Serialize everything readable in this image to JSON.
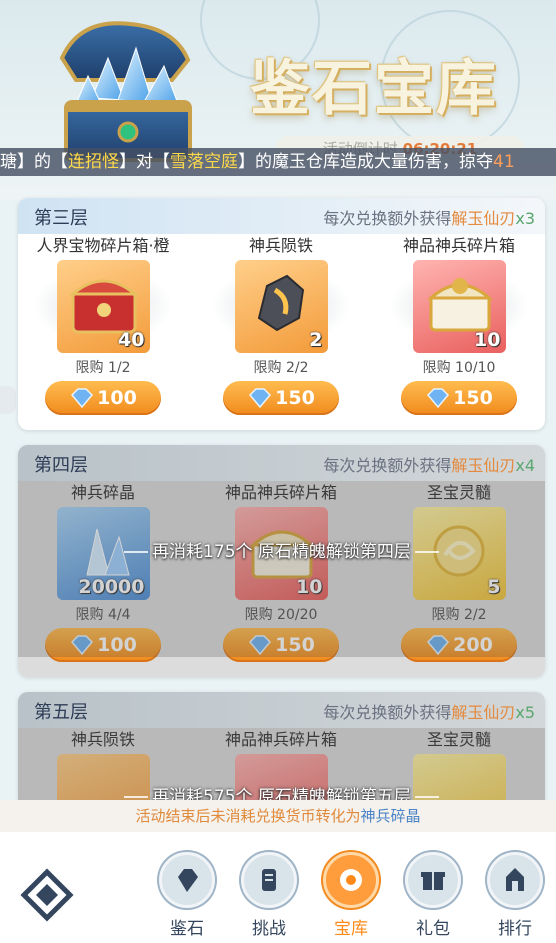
{
  "header": {
    "title": "鉴石宝库",
    "countdown_label": "活动倒计时",
    "countdown_time": "06:20:21",
    "ticker": {
      "part1": "瑭",
      "bracket_open": "】的【",
      "name1": "连招怪",
      "mid": "】对【",
      "place": "雪落空庭",
      "tail": "】的魔玉仓库造成大量伤害，掠夺",
      "amount": "41"
    }
  },
  "tiers": [
    {
      "name": "第三层",
      "bonus_prefix": "每次兑换额外获得",
      "bonus_item": "解玉仙刃",
      "bonus_mult": "x3",
      "locked": false,
      "lock_msg": "",
      "items": [
        {
          "name": "人界宝物碎片箱·橙",
          "qty": "40",
          "limit": "限购 1/2",
          "price": "100"
        },
        {
          "name": "神兵陨铁",
          "qty": "2",
          "limit": "限购 2/2",
          "price": "150"
        },
        {
          "name": "神品神兵碎片箱",
          "qty": "10",
          "limit": "限购 10/10",
          "price": "150"
        }
      ]
    },
    {
      "name": "第四层",
      "bonus_prefix": "每次兑换额外获得",
      "bonus_item": "解玉仙刃",
      "bonus_mult": "x4",
      "locked": true,
      "lock_msg": "再消耗175个  原石精魄解锁第四层",
      "items": [
        {
          "name": "神兵碎晶",
          "qty": "20000",
          "limit": "限购 4/4",
          "price": "100"
        },
        {
          "name": "神品神兵碎片箱",
          "qty": "10",
          "limit": "限购 20/20",
          "price": "150"
        },
        {
          "name": "圣宝灵髓",
          "qty": "5",
          "limit": "限购 2/2",
          "price": "200"
        }
      ]
    },
    {
      "name": "第五层",
      "bonus_prefix": "每次兑换额外获得",
      "bonus_item": "解玉仙刃",
      "bonus_mult": "x5",
      "locked": true,
      "lock_msg": "再消耗575个  原石精魄解锁第五层",
      "items": [
        {
          "name": "神兵陨铁"
        },
        {
          "name": "神品神兵碎片箱"
        },
        {
          "name": "圣宝灵髓"
        }
      ]
    }
  ],
  "footer_note": {
    "prefix": "活动结束后未消耗兑换货币转化为",
    "highlight": "神兵碎晶"
  },
  "nav": {
    "items": [
      {
        "label": "鉴石",
        "icon": "stone-icon"
      },
      {
        "label": "挑战",
        "icon": "scroll-icon"
      },
      {
        "label": "宝库",
        "icon": "treasury-icon",
        "active": true
      },
      {
        "label": "礼包",
        "icon": "gift-icon"
      },
      {
        "label": "排行",
        "icon": "ranking-icon"
      }
    ]
  },
  "colors": {
    "accent_orange": "#f18a1d",
    "bonus_item": "#e48a3e",
    "bonus_mult": "#5aa76f",
    "ticker_highlight": "#ffd94a"
  }
}
